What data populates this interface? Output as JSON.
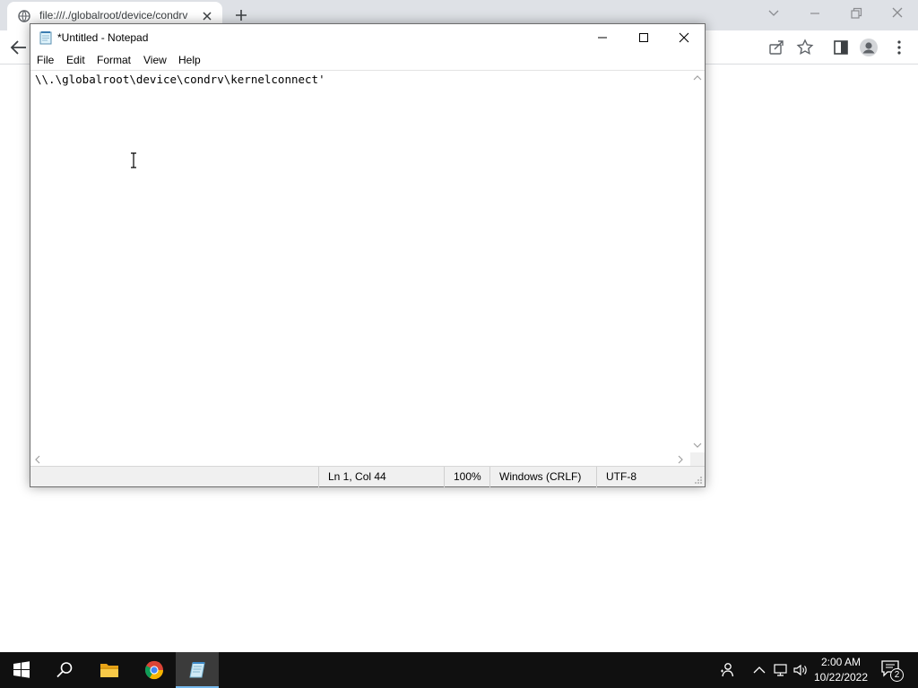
{
  "browser": {
    "tab_title": "file:///./globalroot/device/condrv",
    "icons": {
      "tab": "globe-icon",
      "tab_close": "close-icon",
      "new_tab": "plus-icon",
      "back": "arrow-left-icon",
      "share": "share-icon",
      "bookmark": "star-icon",
      "side_panel": "side-panel-icon",
      "profile": "profile-icon",
      "menu": "kebab-menu-icon"
    }
  },
  "notepad": {
    "title": "*Untitled - Notepad",
    "menu": [
      "File",
      "Edit",
      "Format",
      "View",
      "Help"
    ],
    "text": "\\\\.\\globalroot\\device\\condrv\\kernelconnect'",
    "status": {
      "position": "Ln 1, Col 44",
      "zoom": "100%",
      "line_ending": "Windows (CRLF)",
      "encoding": "UTF-8"
    }
  },
  "taskbar": {
    "time": "2:00 AM",
    "date": "10/22/2022",
    "notification_count": "2",
    "pinned": [
      "start-icon",
      "search-icon",
      "file-explorer-icon",
      "chrome-icon",
      "notepad-icon"
    ]
  },
  "colors": {
    "taskbar_bg": "#101010",
    "tabstrip_bg": "#dee1e6",
    "active_indicator": "#76b9ed",
    "status_bar_bg": "#f0f0f0"
  }
}
